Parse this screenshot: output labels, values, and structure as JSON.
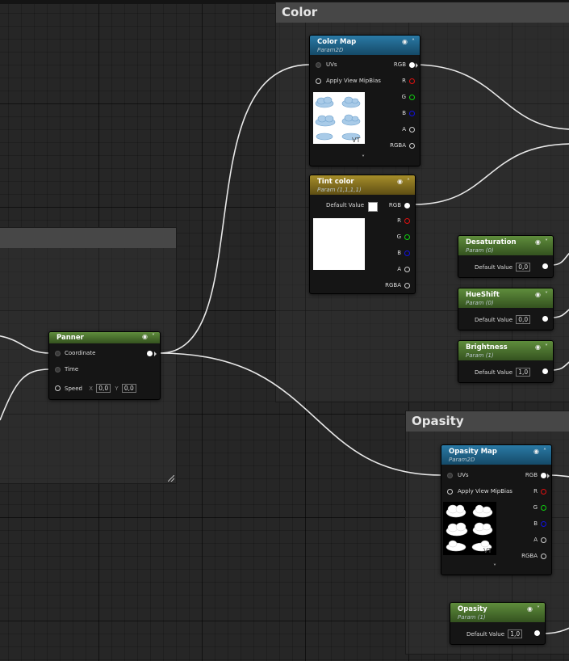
{
  "comments": {
    "color_title": "Color",
    "opasity_title": "Opasity"
  },
  "nodes": {
    "color_map": {
      "title": "Color Map",
      "subtitle": "Param2D",
      "pins": {
        "uvs": "UVs",
        "apply_view_mip_bias": "Apply View MipBias",
        "rgb": "RGB",
        "r": "R",
        "g": "G",
        "b": "B",
        "a": "A",
        "rgba": "RGBA"
      },
      "vt_label": "VT"
    },
    "tint_color": {
      "title": "Tint color",
      "subtitle": "Param (1,1,1,1)",
      "default_value_label": "Default Value",
      "pins": {
        "rgb": "RGB",
        "r": "R",
        "g": "G",
        "b": "B",
        "a": "A",
        "rgba": "RGBA"
      },
      "swatch_color": "#ffffff"
    },
    "desaturation": {
      "title": "Desaturation",
      "subtitle": "Param (0)",
      "default_value_label": "Default Value",
      "value": "0,0"
    },
    "hueshift": {
      "title": "HueShift",
      "subtitle": "Param (0)",
      "default_value_label": "Default Value",
      "value": "0,0"
    },
    "brightness": {
      "title": "Brightness",
      "subtitle": "Param (1)",
      "default_value_label": "Default Value",
      "value": "1,0"
    },
    "panner": {
      "title": "Panner",
      "pins": {
        "coordinate": "Coordinate",
        "time": "Time",
        "speed": "Speed"
      },
      "speed_x_label": "X",
      "speed_x": "0,0",
      "speed_y_label": "Y",
      "speed_y": "0,0"
    },
    "opasity_map": {
      "title": "Opasity Map",
      "subtitle": "Param2D",
      "pins": {
        "uvs": "UVs",
        "apply_view_mip_bias": "Apply View MipBias",
        "rgb": "RGB",
        "r": "R",
        "g": "G",
        "b": "B",
        "a": "A",
        "rgba": "RGBA"
      },
      "vt_label": "VT"
    },
    "opasity": {
      "title": "Opasity",
      "subtitle": "Param (1)",
      "default_value_label": "Default Value",
      "value": "1,0"
    }
  },
  "colors": {
    "param_header_blue": "#2a7aa6",
    "param_header_gold": "#a68e2a",
    "param_header_green": "#5f8d3c",
    "pin_red": "#e01010",
    "pin_green": "#10d010",
    "pin_blue": "#1010e0",
    "wire": "#e8e8e8"
  },
  "icons": [
    "eye-icon",
    "chevron-up-icon",
    "chevron-down-icon",
    "resize-grip-icon"
  ]
}
